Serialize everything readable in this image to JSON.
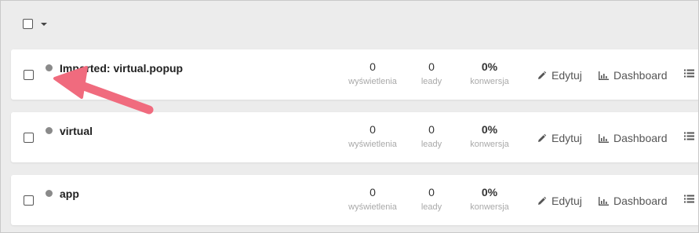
{
  "bulk": {
    "select_all_icon": "checkbox-icon",
    "dropdown_icon": "chevron-down-icon"
  },
  "rows": [
    {
      "title": "Imported: virtual.popup",
      "views": "0",
      "views_label": "wyświetlenia",
      "leads": "0",
      "leads_label": "leady",
      "conversion": "0%",
      "conversion_label": "konwersja",
      "edit_label": "Edytuj",
      "dashboard_label": "Dashboard"
    },
    {
      "title": "virtual",
      "views": "0",
      "views_label": "wyświetlenia",
      "leads": "0",
      "leads_label": "leady",
      "conversion": "0%",
      "conversion_label": "konwersja",
      "edit_label": "Edytuj",
      "dashboard_label": "Dashboard"
    },
    {
      "title": "app",
      "views": "0",
      "views_label": "wyświetlenia",
      "leads": "0",
      "leads_label": "leady",
      "conversion": "0%",
      "conversion_label": "konwersja",
      "edit_label": "Edytuj",
      "dashboard_label": "Dashboard"
    }
  ],
  "colors": {
    "status_dot": "#8a8a8a",
    "annotation_arrow": "#f06b7e",
    "background": "#ececec"
  },
  "icons": {
    "edit": "pencil-icon",
    "dashboard": "bar-chart-icon",
    "more": "list-menu-icon"
  }
}
